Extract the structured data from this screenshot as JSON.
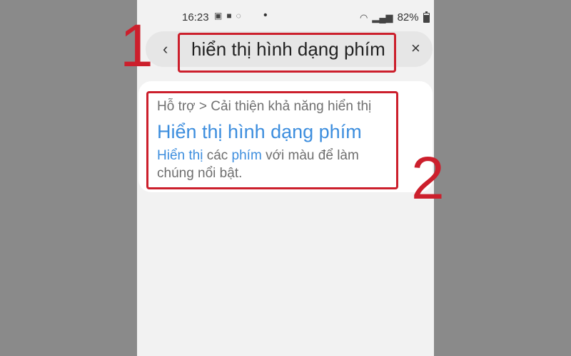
{
  "status_bar": {
    "time": "16:23",
    "dot": "•",
    "battery": "82%",
    "icons": [
      "image-icon",
      "video-call-icon",
      "viber-icon",
      "wifi-icon",
      "signal-icon",
      "battery-icon"
    ]
  },
  "search": {
    "back_glyph": "‹",
    "query": "hiển thị hình dạng phím",
    "clear_glyph": "×"
  },
  "result": {
    "breadcrumb": "Hỗ trợ > Cải thiện khả năng hiển thị",
    "title": "Hiển thị hình dạng phím",
    "desc_hl_1": "Hiển thị",
    "desc_text_1": " các ",
    "desc_hl_2": "phím",
    "desc_text_2": " với màu để làm chúng nổi bật."
  },
  "annotations": {
    "step_1": "1",
    "step_2": "2",
    "color": "#cc1f2c"
  },
  "colors": {
    "highlight_blue": "#3d8ede"
  }
}
